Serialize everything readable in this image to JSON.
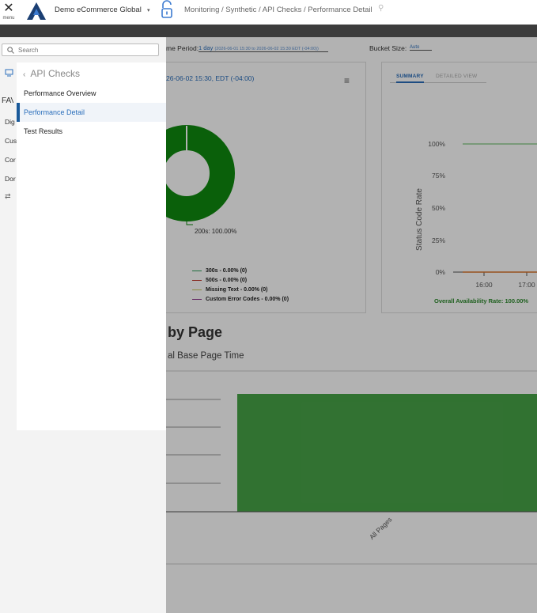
{
  "header": {
    "menu_label": "menu",
    "org_name": "Demo eCommerce Global",
    "breadcrumb": "Monitoring / Synthetic / API Checks / Performance Detail",
    "icons": {
      "menu": "close-icon",
      "logo": "app-logo",
      "lock": "lock-icon",
      "pin": "pin-icon"
    }
  },
  "filters": {
    "period_label": "me Period:",
    "period_value": "1 day",
    "period_range": "(2026-06-01 15:30 to 2026-06-02 15:30 EDT (-04:00))",
    "bucket_label": "Bucket Size:",
    "bucket_value": "Auto"
  },
  "donut_card": {
    "date_text": "26-06-02 15:30, EDT (-04:00)",
    "slice_label": "200s: 100.00%",
    "legend": [
      {
        "label": "300s - 0.00% (0)",
        "color": "#2e9e5a"
      },
      {
        "label": "500s - 0.00% (0)",
        "color": "#c0392b"
      },
      {
        "label": "Missing Text - 0.00% (0)",
        "color": "#c8c85a"
      },
      {
        "label": "Custom Error Codes - 0.00% (0)",
        "color": "#8e3a8e"
      }
    ]
  },
  "rate_card": {
    "tabs": [
      "SUMMARY",
      "DETAILED VIEW"
    ],
    "ylabel": "Status Code Rate",
    "yticks": [
      "100%",
      "75%",
      "50%",
      "25%",
      "0%"
    ],
    "xticks": [
      "16:00",
      "17:00"
    ],
    "footer": "Overall Availability Rate: 100.00%"
  },
  "page_section": {
    "title": "by Page",
    "subtitle": "al Base Page Time",
    "category": "All Pages"
  },
  "side_menu": {
    "search_placeholder": "Search",
    "rail_items": [
      "FAV",
      "Dig",
      "Cus",
      "Cor",
      "Dor"
    ],
    "submenu_title": "API Checks",
    "submenu_items": [
      "Performance Overview",
      "Performance Detail",
      "Test Results"
    ],
    "selected_item": "Performance Detail"
  },
  "colors": {
    "accent": "#2a6ebb",
    "success": "#1e9b1e",
    "bar": "#47a447",
    "darkbar": "#3c3c3c"
  }
}
